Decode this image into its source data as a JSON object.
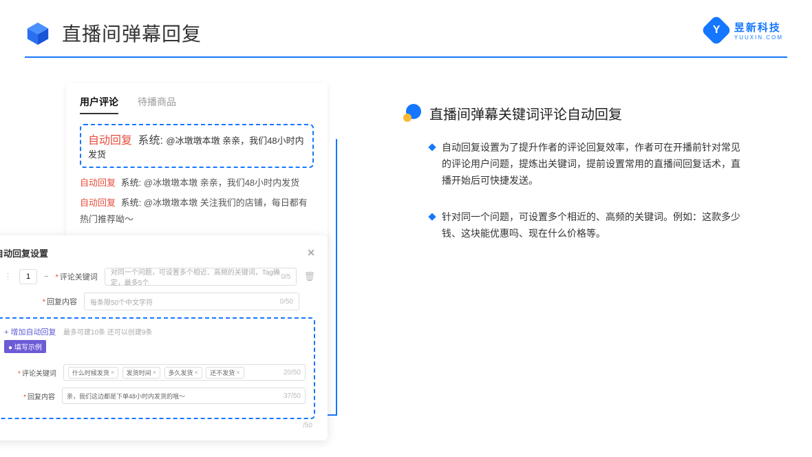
{
  "header": {
    "title": "直播间弹幕回复"
  },
  "logo": {
    "cn": "昱新科技",
    "en": "YUUXIN.COM"
  },
  "tabs": {
    "active": "用户评论",
    "inactive": "待播商品"
  },
  "highlighted_comment": {
    "tag": "自动回复",
    "sys": "系统:",
    "text": "@冰墩墩本墩 亲亲，我们48小时内发货"
  },
  "comments": [
    {
      "tag": "自动回复",
      "sys": "系统:",
      "text": "@冰墩墩本墩 亲亲，我们48小时内发货"
    },
    {
      "tag": "自动回复",
      "sys": "系统:",
      "text": "@冰墩墩本墩 关注我们的店铺，每日都有热门推荐呦～"
    }
  ],
  "dialog": {
    "title": "自动回复设置",
    "row_num": "1",
    "label_keyword": "评论关键词",
    "placeholder_keyword": "对同一个问题，可设置多个相近、高频的关键词，Tag确定，最多5个",
    "count_keyword": "0/5",
    "label_content": "回复内容",
    "placeholder_content": "每条限50个中文字符",
    "count_content": "0/50",
    "add_link": "+ 增加自动回复",
    "add_hint": "最多可建10条 还可以创建9条",
    "example_tag": "● 填写示例",
    "ex_label_keyword": "评论关键词",
    "ex_tags": [
      "什么时候发货",
      "发货时间",
      "多久发货",
      "还不发货"
    ],
    "ex_count_keyword": "20/50",
    "ex_label_content": "回复内容",
    "ex_content": "亲，我们这边都是下单48小时内发货的哦～",
    "ex_count_content": "37/50",
    "outer_count": "/50"
  },
  "subtitle": "直播间弹幕关键词评论自动回复",
  "bullets": [
    "自动回复设置为了提升作者的评论回复效率，作者可在开播前针对常见的评论用户问题，提炼出关键词，提前设置常用的直播间回复话术，直播开始后可快捷发送。",
    "针对同一个问题，可设置多个相近的、高频的关键词。例如：这款多少钱、这块能优惠吗、现在什么价格等。"
  ]
}
